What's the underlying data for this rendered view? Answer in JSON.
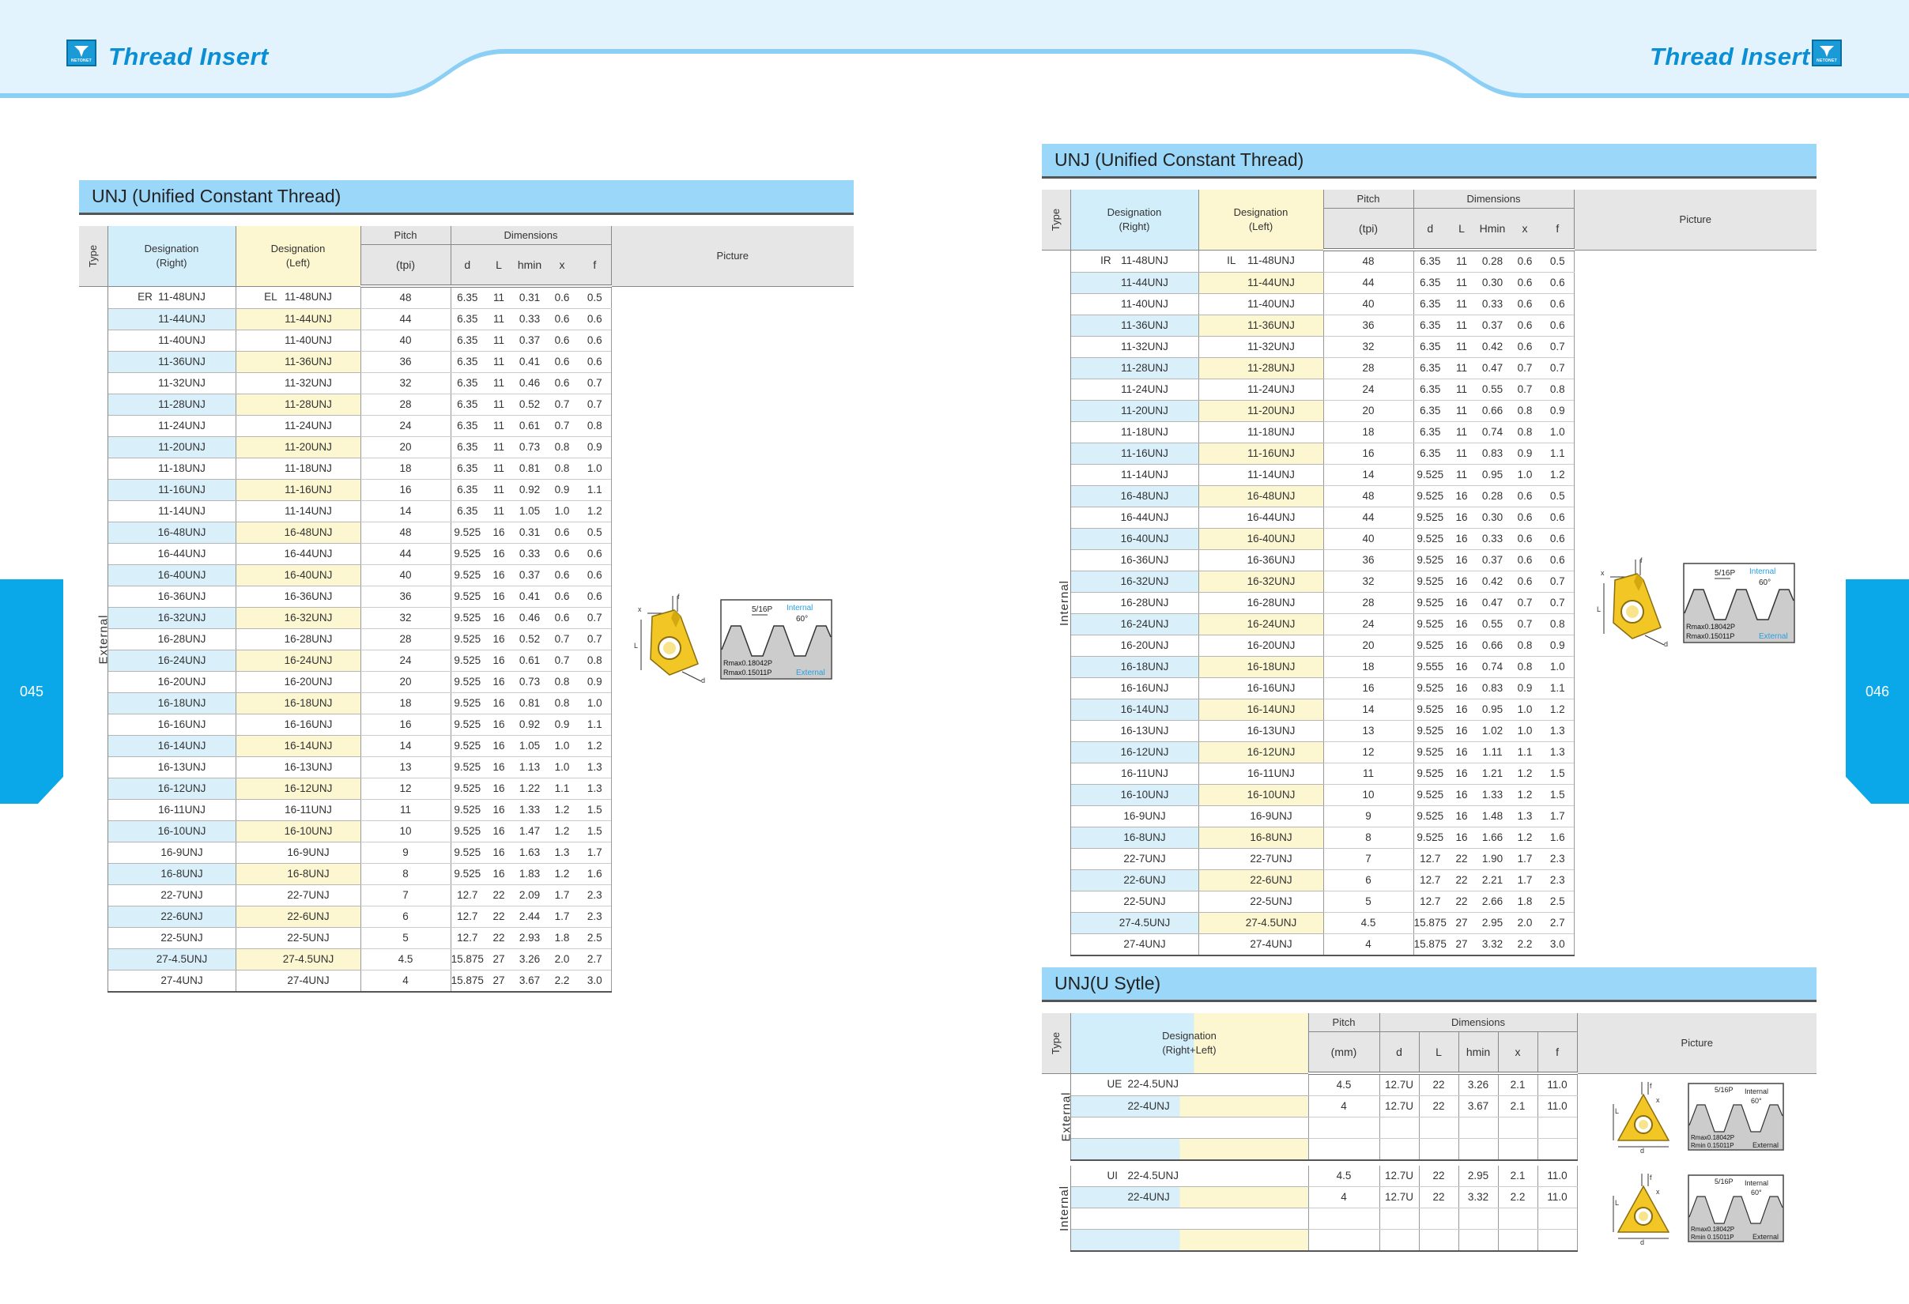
{
  "header": {
    "brand_left": "Thread  Insert",
    "brand_right": "Thread  Insert",
    "logo_text": "NETONET",
    "page_left": "045",
    "page_right": "046"
  },
  "colors": {
    "banner": "#e3f3fd",
    "wave": "#8ccff5",
    "accent": "#0aa8e8",
    "section": "#9bd7f8",
    "des_right": "#d2eefa",
    "des_left": "#fcf7d0"
  },
  "headers": {
    "type": "Type",
    "des_right": "Designation\n(Right)",
    "des_left": "Designation\n(Left)",
    "des_both": "Designation\n(Right+Left)",
    "pitch": "Pitch",
    "tpi": "(tpi)",
    "mm": "(mm)",
    "dimensions": "Dimensions",
    "d": "d",
    "L": "L",
    "hmin": "hmin",
    "Hmin": "Hmin",
    "x": "x",
    "f": "f",
    "picture": "Picture"
  },
  "figure_labels": {
    "pitch": "5/16P",
    "internal": "Internal",
    "external": "External",
    "angle": "60°",
    "rmax1": "Rmax0.18042P",
    "rmax2": "Rmax0.15011P",
    "rmin": "Rmin 0.15011P",
    "d": "d",
    "L": "L",
    "x": "x",
    "f": "f"
  },
  "left_section": {
    "title": "UNJ (Unified Constant Thread)",
    "type_label": "External",
    "right_prefix": "ER",
    "left_prefix": "EL",
    "rows": [
      {
        "r": "11-48UNJ",
        "l": "11-48UNJ",
        "p": "48",
        "d": "6.35",
        "L": "11",
        "h": "0.31",
        "x": "0.6",
        "f": "0.5"
      },
      {
        "r": "11-44UNJ",
        "l": "11-44UNJ",
        "p": "44",
        "d": "6.35",
        "L": "11",
        "h": "0.33",
        "x": "0.6",
        "f": "0.6"
      },
      {
        "r": "11-40UNJ",
        "l": "11-40UNJ",
        "p": "40",
        "d": "6.35",
        "L": "11",
        "h": "0.37",
        "x": "0.6",
        "f": "0.6"
      },
      {
        "r": "11-36UNJ",
        "l": "11-36UNJ",
        "p": "36",
        "d": "6.35",
        "L": "11",
        "h": "0.41",
        "x": "0.6",
        "f": "0.6"
      },
      {
        "r": "11-32UNJ",
        "l": "11-32UNJ",
        "p": "32",
        "d": "6.35",
        "L": "11",
        "h": "0.46",
        "x": "0.6",
        "f": "0.7"
      },
      {
        "r": "11-28UNJ",
        "l": "11-28UNJ",
        "p": "28",
        "d": "6.35",
        "L": "11",
        "h": "0.52",
        "x": "0.7",
        "f": "0.7"
      },
      {
        "r": "11-24UNJ",
        "l": "11-24UNJ",
        "p": "24",
        "d": "6.35",
        "L": "11",
        "h": "0.61",
        "x": "0.7",
        "f": "0.8"
      },
      {
        "r": "11-20UNJ",
        "l": "11-20UNJ",
        "p": "20",
        "d": "6.35",
        "L": "11",
        "h": "0.73",
        "x": "0.8",
        "f": "0.9"
      },
      {
        "r": "11-18UNJ",
        "l": "11-18UNJ",
        "p": "18",
        "d": "6.35",
        "L": "11",
        "h": "0.81",
        "x": "0.8",
        "f": "1.0"
      },
      {
        "r": "11-16UNJ",
        "l": "11-16UNJ",
        "p": "16",
        "d": "6.35",
        "L": "11",
        "h": "0.92",
        "x": "0.9",
        "f": "1.1"
      },
      {
        "r": "11-14UNJ",
        "l": "11-14UNJ",
        "p": "14",
        "d": "6.35",
        "L": "11",
        "h": "1.05",
        "x": "1.0",
        "f": "1.2"
      },
      {
        "r": "16-48UNJ",
        "l": "16-48UNJ",
        "p": "48",
        "d": "9.525",
        "L": "16",
        "h": "0.31",
        "x": "0.6",
        "f": "0.5"
      },
      {
        "r": "16-44UNJ",
        "l": "16-44UNJ",
        "p": "44",
        "d": "9.525",
        "L": "16",
        "h": "0.33",
        "x": "0.6",
        "f": "0.6"
      },
      {
        "r": "16-40UNJ",
        "l": "16-40UNJ",
        "p": "40",
        "d": "9.525",
        "L": "16",
        "h": "0.37",
        "x": "0.6",
        "f": "0.6"
      },
      {
        "r": "16-36UNJ",
        "l": "16-36UNJ",
        "p": "36",
        "d": "9.525",
        "L": "16",
        "h": "0.41",
        "x": "0.6",
        "f": "0.6"
      },
      {
        "r": "16-32UNJ",
        "l": "16-32UNJ",
        "p": "32",
        "d": "9.525",
        "L": "16",
        "h": "0.46",
        "x": "0.6",
        "f": "0.7"
      },
      {
        "r": "16-28UNJ",
        "l": "16-28UNJ",
        "p": "28",
        "d": "9.525",
        "L": "16",
        "h": "0.52",
        "x": "0.7",
        "f": "0.7"
      },
      {
        "r": "16-24UNJ",
        "l": "16-24UNJ",
        "p": "24",
        "d": "9.525",
        "L": "16",
        "h": "0.61",
        "x": "0.7",
        "f": "0.8"
      },
      {
        "r": "16-20UNJ",
        "l": "16-20UNJ",
        "p": "20",
        "d": "9.525",
        "L": "16",
        "h": "0.73",
        "x": "0.8",
        "f": "0.9"
      },
      {
        "r": "16-18UNJ",
        "l": "16-18UNJ",
        "p": "18",
        "d": "9.525",
        "L": "16",
        "h": "0.81",
        "x": "0.8",
        "f": "1.0"
      },
      {
        "r": "16-16UNJ",
        "l": "16-16UNJ",
        "p": "16",
        "d": "9.525",
        "L": "16",
        "h": "0.92",
        "x": "0.9",
        "f": "1.1"
      },
      {
        "r": "16-14UNJ",
        "l": "16-14UNJ",
        "p": "14",
        "d": "9.525",
        "L": "16",
        "h": "1.05",
        "x": "1.0",
        "f": "1.2"
      },
      {
        "r": "16-13UNJ",
        "l": "16-13UNJ",
        "p": "13",
        "d": "9.525",
        "L": "16",
        "h": "1.13",
        "x": "1.0",
        "f": "1.3"
      },
      {
        "r": "16-12UNJ",
        "l": "16-12UNJ",
        "p": "12",
        "d": "9.525",
        "L": "16",
        "h": "1.22",
        "x": "1.1",
        "f": "1.3"
      },
      {
        "r": "16-11UNJ",
        "l": "16-11UNJ",
        "p": "11",
        "d": "9.525",
        "L": "16",
        "h": "1.33",
        "x": "1.2",
        "f": "1.5"
      },
      {
        "r": "16-10UNJ",
        "l": "16-10UNJ",
        "p": "10",
        "d": "9.525",
        "L": "16",
        "h": "1.47",
        "x": "1.2",
        "f": "1.5"
      },
      {
        "r": "16-9UNJ",
        "l": "16-9UNJ",
        "p": "9",
        "d": "9.525",
        "L": "16",
        "h": "1.63",
        "x": "1.3",
        "f": "1.7"
      },
      {
        "r": "16-8UNJ",
        "l": "16-8UNJ",
        "p": "8",
        "d": "9.525",
        "L": "16",
        "h": "1.83",
        "x": "1.2",
        "f": "1.6"
      },
      {
        "r": "22-7UNJ",
        "l": "22-7UNJ",
        "p": "7",
        "d": "12.7",
        "L": "22",
        "h": "2.09",
        "x": "1.7",
        "f": "2.3"
      },
      {
        "r": "22-6UNJ",
        "l": "22-6UNJ",
        "p": "6",
        "d": "12.7",
        "L": "22",
        "h": "2.44",
        "x": "1.7",
        "f": "2.3"
      },
      {
        "r": "22-5UNJ",
        "l": "22-5UNJ",
        "p": "5",
        "d": "12.7",
        "L": "22",
        "h": "2.93",
        "x": "1.8",
        "f": "2.5"
      },
      {
        "r": "27-4.5UNJ",
        "l": "27-4.5UNJ",
        "p": "4.5",
        "d": "15.875",
        "L": "27",
        "h": "3.26",
        "x": "2.0",
        "f": "2.7"
      },
      {
        "r": "27-4UNJ",
        "l": "27-4UNJ",
        "p": "4",
        "d": "15.875",
        "L": "27",
        "h": "3.67",
        "x": "2.2",
        "f": "3.0"
      }
    ]
  },
  "right_section": {
    "title": "UNJ (Unified Constant Thread)",
    "type_label": "Internal",
    "right_prefix": "IR",
    "left_prefix": "IL",
    "rows": [
      {
        "r": "11-48UNJ",
        "l": "11-48UNJ",
        "p": "48",
        "d": "6.35",
        "L": "11",
        "h": "0.28",
        "x": "0.6",
        "f": "0.5"
      },
      {
        "r": "11-44UNJ",
        "l": "11-44UNJ",
        "p": "44",
        "d": "6.35",
        "L": "11",
        "h": "0.30",
        "x": "0.6",
        "f": "0.6"
      },
      {
        "r": "11-40UNJ",
        "l": "11-40UNJ",
        "p": "40",
        "d": "6.35",
        "L": "11",
        "h": "0.33",
        "x": "0.6",
        "f": "0.6"
      },
      {
        "r": "11-36UNJ",
        "l": "11-36UNJ",
        "p": "36",
        "d": "6.35",
        "L": "11",
        "h": "0.37",
        "x": "0.6",
        "f": "0.6"
      },
      {
        "r": "11-32UNJ",
        "l": "11-32UNJ",
        "p": "32",
        "d": "6.35",
        "L": "11",
        "h": "0.42",
        "x": "0.6",
        "f": "0.7"
      },
      {
        "r": "11-28UNJ",
        "l": "11-28UNJ",
        "p": "28",
        "d": "6.35",
        "L": "11",
        "h": "0.47",
        "x": "0.7",
        "f": "0.7"
      },
      {
        "r": "11-24UNJ",
        "l": "11-24UNJ",
        "p": "24",
        "d": "6.35",
        "L": "11",
        "h": "0.55",
        "x": "0.7",
        "f": "0.8"
      },
      {
        "r": "11-20UNJ",
        "l": "11-20UNJ",
        "p": "20",
        "d": "6.35",
        "L": "11",
        "h": "0.66",
        "x": "0.8",
        "f": "0.9"
      },
      {
        "r": "11-18UNJ",
        "l": "11-18UNJ",
        "p": "18",
        "d": "6.35",
        "L": "11",
        "h": "0.74",
        "x": "0.8",
        "f": "1.0"
      },
      {
        "r": "11-16UNJ",
        "l": "11-16UNJ",
        "p": "16",
        "d": "6.35",
        "L": "11",
        "h": "0.83",
        "x": "0.9",
        "f": "1.1"
      },
      {
        "r": "11-14UNJ",
        "l": "11-14UNJ",
        "p": "14",
        "d": "9.525",
        "L": "11",
        "h": "0.95",
        "x": "1.0",
        "f": "1.2"
      },
      {
        "r": "16-48UNJ",
        "l": "16-48UNJ",
        "p": "48",
        "d": "9.525",
        "L": "16",
        "h": "0.28",
        "x": "0.6",
        "f": "0.5"
      },
      {
        "r": "16-44UNJ",
        "l": "16-44UNJ",
        "p": "44",
        "d": "9.525",
        "L": "16",
        "h": "0.30",
        "x": "0.6",
        "f": "0.6"
      },
      {
        "r": "16-40UNJ",
        "l": "16-40UNJ",
        "p": "40",
        "d": "9.525",
        "L": "16",
        "h": "0.33",
        "x": "0.6",
        "f": "0.6"
      },
      {
        "r": "16-36UNJ",
        "l": "16-36UNJ",
        "p": "36",
        "d": "9.525",
        "L": "16",
        "h": "0.37",
        "x": "0.6",
        "f": "0.6"
      },
      {
        "r": "16-32UNJ",
        "l": "16-32UNJ",
        "p": "32",
        "d": "9.525",
        "L": "16",
        "h": "0.42",
        "x": "0.6",
        "f": "0.7"
      },
      {
        "r": "16-28UNJ",
        "l": "16-28UNJ",
        "p": "28",
        "d": "9.525",
        "L": "16",
        "h": "0.47",
        "x": "0.7",
        "f": "0.7"
      },
      {
        "r": "16-24UNJ",
        "l": "16-24UNJ",
        "p": "24",
        "d": "9.525",
        "L": "16",
        "h": "0.55",
        "x": "0.7",
        "f": "0.8"
      },
      {
        "r": "16-20UNJ",
        "l": "16-20UNJ",
        "p": "20",
        "d": "9.525",
        "L": "16",
        "h": "0.66",
        "x": "0.8",
        "f": "0.9"
      },
      {
        "r": "16-18UNJ",
        "l": "16-18UNJ",
        "p": "18",
        "d": "9.555",
        "L": "16",
        "h": "0.74",
        "x": "0.8",
        "f": "1.0"
      },
      {
        "r": "16-16UNJ",
        "l": "16-16UNJ",
        "p": "16",
        "d": "9.525",
        "L": "16",
        "h": "0.83",
        "x": "0.9",
        "f": "1.1"
      },
      {
        "r": "16-14UNJ",
        "l": "16-14UNJ",
        "p": "14",
        "d": "9.525",
        "L": "16",
        "h": "0.95",
        "x": "1.0",
        "f": "1.2"
      },
      {
        "r": "16-13UNJ",
        "l": "16-13UNJ",
        "p": "13",
        "d": "9.525",
        "L": "16",
        "h": "1.02",
        "x": "1.0",
        "f": "1.3"
      },
      {
        "r": "16-12UNJ",
        "l": "16-12UNJ",
        "p": "12",
        "d": "9.525",
        "L": "16",
        "h": "1.11",
        "x": "1.1",
        "f": "1.3"
      },
      {
        "r": "16-11UNJ",
        "l": "16-11UNJ",
        "p": "11",
        "d": "9.525",
        "L": "16",
        "h": "1.21",
        "x": "1.2",
        "f": "1.5"
      },
      {
        "r": "16-10UNJ",
        "l": "16-10UNJ",
        "p": "10",
        "d": "9.525",
        "L": "16",
        "h": "1.33",
        "x": "1.2",
        "f": "1.5"
      },
      {
        "r": "16-9UNJ",
        "l": "16-9UNJ",
        "p": "9",
        "d": "9.525",
        "L": "16",
        "h": "1.48",
        "x": "1.3",
        "f": "1.7"
      },
      {
        "r": "16-8UNJ",
        "l": "16-8UNJ",
        "p": "8",
        "d": "9.525",
        "L": "16",
        "h": "1.66",
        "x": "1.2",
        "f": "1.6"
      },
      {
        "r": "22-7UNJ",
        "l": "22-7UNJ",
        "p": "7",
        "d": "12.7",
        "L": "22",
        "h": "1.90",
        "x": "1.7",
        "f": "2.3"
      },
      {
        "r": "22-6UNJ",
        "l": "22-6UNJ",
        "p": "6",
        "d": "12.7",
        "L": "22",
        "h": "2.21",
        "x": "1.7",
        "f": "2.3"
      },
      {
        "r": "22-5UNJ",
        "l": "22-5UNJ",
        "p": "5",
        "d": "12.7",
        "L": "22",
        "h": "2.66",
        "x": "1.8",
        "f": "2.5"
      },
      {
        "r": "27-4.5UNJ",
        "l": "27-4.5UNJ",
        "p": "4.5",
        "d": "15.875",
        "L": "27",
        "h": "2.95",
        "x": "2.0",
        "f": "2.7"
      },
      {
        "r": "27-4UNJ",
        "l": "27-4UNJ",
        "p": "4",
        "d": "15.875",
        "L": "27",
        "h": "3.32",
        "x": "2.2",
        "f": "3.0"
      }
    ]
  },
  "u_section": {
    "title": "UNJ(U Sytle)",
    "groups": [
      {
        "type_label": "External",
        "prefix": "UE",
        "rows": [
          {
            "des": "22-4.5UNJ",
            "p": "4.5",
            "d": "12.7U",
            "L": "22",
            "h": "3.26",
            "x": "2.1",
            "f": "11.0"
          },
          {
            "des": "22-4UNJ",
            "p": "4",
            "d": "12.7U",
            "L": "22",
            "h": "3.67",
            "x": "2.1",
            "f": "11.0"
          }
        ]
      },
      {
        "type_label": "Internal",
        "prefix": "UI",
        "rows": [
          {
            "des": "22-4.5UNJ",
            "p": "4.5",
            "d": "12.7U",
            "L": "22",
            "h": "2.95",
            "x": "2.1",
            "f": "11.0"
          },
          {
            "des": "22-4UNJ",
            "p": "4",
            "d": "12.7U",
            "L": "22",
            "h": "3.32",
            "x": "2.2",
            "f": "11.0"
          }
        ]
      }
    ]
  }
}
